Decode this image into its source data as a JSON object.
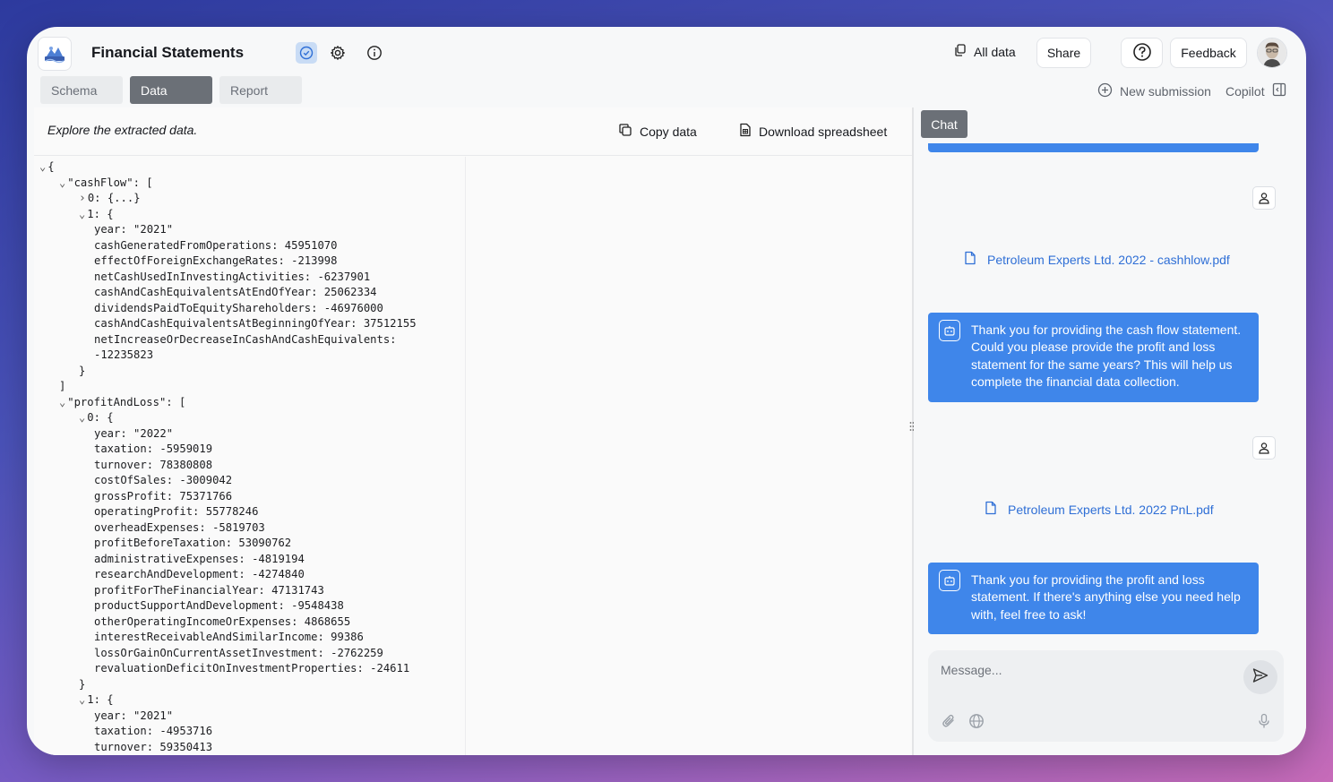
{
  "header": {
    "title": "Financial Statements",
    "all_data": "All data",
    "share": "Share",
    "feedback": "Feedback"
  },
  "tabs": [
    {
      "label": "Schema"
    },
    {
      "label": "Data"
    },
    {
      "label": "Report"
    }
  ],
  "actions": {
    "new_submission": "New submission",
    "copilot": "Copilot"
  },
  "left_panel": {
    "subtitle": "Explore the extracted data.",
    "copy_data": "Copy data",
    "download_spreadsheet": "Download spreadsheet"
  },
  "json_lines": [
    {
      "caret": "v",
      "text": "{",
      "indent": 0
    },
    {
      "caret": "v",
      "text": "\"cashFlow\": [",
      "indent": 1
    },
    {
      "caret": ">",
      "text": "0: {...}",
      "indent": 2
    },
    {
      "caret": "v",
      "text": "1: {",
      "indent": 2
    },
    {
      "caret": "",
      "text": "year: \"2021\"",
      "indent": 3
    },
    {
      "caret": "",
      "text": "cashGeneratedFromOperations: 45951070",
      "indent": 3
    },
    {
      "caret": "",
      "text": "effectOfForeignExchangeRates: -213998",
      "indent": 3
    },
    {
      "caret": "",
      "text": "netCashUsedInInvestingActivities: -6237901",
      "indent": 3
    },
    {
      "caret": "",
      "text": "cashAndCashEquivalentsAtEndOfYear: 25062334",
      "indent": 3
    },
    {
      "caret": "",
      "text": "dividendsPaidToEquityShareholders: -46976000",
      "indent": 3
    },
    {
      "caret": "",
      "text": "cashAndCashEquivalentsAtBeginningOfYear: 37512155",
      "indent": 3
    },
    {
      "caret": "",
      "text": "netIncreaseOrDecreaseInCashAndCashEquivalents:",
      "indent": 3
    },
    {
      "caret": "",
      "text": "-12235823",
      "indent": 3
    },
    {
      "caret": "",
      "text": "}",
      "indent": 2
    },
    {
      "caret": "",
      "text": "]",
      "indent": 1
    },
    {
      "caret": "v",
      "text": "\"profitAndLoss\": [",
      "indent": 1
    },
    {
      "caret": "v",
      "text": "0: {",
      "indent": 2
    },
    {
      "caret": "",
      "text": "year: \"2022\"",
      "indent": 3
    },
    {
      "caret": "",
      "text": "taxation: -5959019",
      "indent": 3
    },
    {
      "caret": "",
      "text": "turnover: 78380808",
      "indent": 3
    },
    {
      "caret": "",
      "text": "costOfSales: -3009042",
      "indent": 3
    },
    {
      "caret": "",
      "text": "grossProfit: 75371766",
      "indent": 3
    },
    {
      "caret": "",
      "text": "operatingProfit: 55778246",
      "indent": 3
    },
    {
      "caret": "",
      "text": "overheadExpenses: -5819703",
      "indent": 3
    },
    {
      "caret": "",
      "text": "profitBeforeTaxation: 53090762",
      "indent": 3
    },
    {
      "caret": "",
      "text": "administrativeExpenses: -4819194",
      "indent": 3
    },
    {
      "caret": "",
      "text": "researchAndDevelopment: -4274840",
      "indent": 3
    },
    {
      "caret": "",
      "text": "profitForTheFinancialYear: 47131743",
      "indent": 3
    },
    {
      "caret": "",
      "text": "productSupportAndDevelopment: -9548438",
      "indent": 3
    },
    {
      "caret": "",
      "text": "otherOperatingIncomeOrExpenses: 4868655",
      "indent": 3
    },
    {
      "caret": "",
      "text": "interestReceivableAndSimilarIncome: 99386",
      "indent": 3
    },
    {
      "caret": "",
      "text": "lossOrGainOnCurrentAssetInvestment: -2762259",
      "indent": 3
    },
    {
      "caret": "",
      "text": "revaluationDeficitOnInvestmentProperties: -24611",
      "indent": 3
    },
    {
      "caret": "",
      "text": "}",
      "indent": 2
    },
    {
      "caret": "v",
      "text": "1: {",
      "indent": 2
    },
    {
      "caret": "",
      "text": "year: \"2021\"",
      "indent": 3
    },
    {
      "caret": "",
      "text": "taxation: -4953716",
      "indent": 3
    },
    {
      "caret": "",
      "text": "turnover: 59350413",
      "indent": 3
    }
  ],
  "chat": {
    "tab_label": "Chat",
    "file_1": "Petroleum Experts Ltd. 2022 - cashhlow.pdf",
    "bot_message_1": "Thank you for providing the cash flow statement. Could you please provide the profit and loss statement for the same years? This will help us complete the financial data collection.",
    "file_2": "Petroleum Experts Ltd. 2022 PnL.pdf",
    "bot_message_2": "Thank you for providing the profit and loss statement. If there's anything else you need help with, feel free to ask!",
    "input_placeholder": "Message..."
  },
  "colors": {
    "accent": "#3f86ea",
    "active_tab": "#6b7077",
    "link": "#2f6fd6"
  },
  "icons": [
    "logo-icon",
    "check-circle-icon",
    "gear-icon",
    "info-icon",
    "copy-icon",
    "help-icon",
    "plus-circle-icon",
    "sidebar-panel-icon",
    "document-icon",
    "user-icon",
    "bot-icon",
    "send-icon",
    "paperclip-icon",
    "globe-icon",
    "microphone-icon"
  ]
}
